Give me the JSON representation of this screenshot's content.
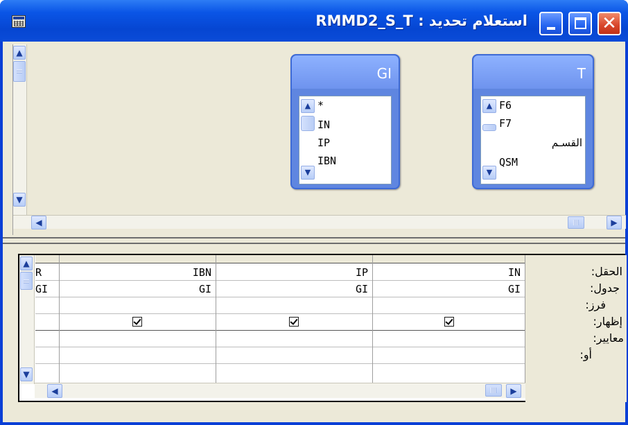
{
  "window": {
    "title": "RMMD2_S_T : استعلام تحديد",
    "icon": "query-window-icon"
  },
  "tables": [
    {
      "name": "GI",
      "fields": [
        "*",
        "IN",
        "IP",
        "IBN"
      ]
    },
    {
      "name": "T",
      "fields": [
        "F6",
        "F7",
        "القسـم",
        "QSM"
      ]
    }
  ],
  "grid": {
    "row_labels": [
      "الحقل:",
      "جدول:",
      "فرز:",
      "إظهار:",
      "معايير:",
      "أو:"
    ],
    "columns": [
      {
        "field": "IN",
        "table": "GI",
        "show": true
      },
      {
        "field": "IP",
        "table": "GI",
        "show": true
      },
      {
        "field": "IBN",
        "table": "GI",
        "show": true
      },
      {
        "field": "R",
        "table": "GI",
        "show": true
      }
    ]
  },
  "scroll": {
    "up": "^",
    "down": "v",
    "left": "<",
    "right": ">"
  }
}
